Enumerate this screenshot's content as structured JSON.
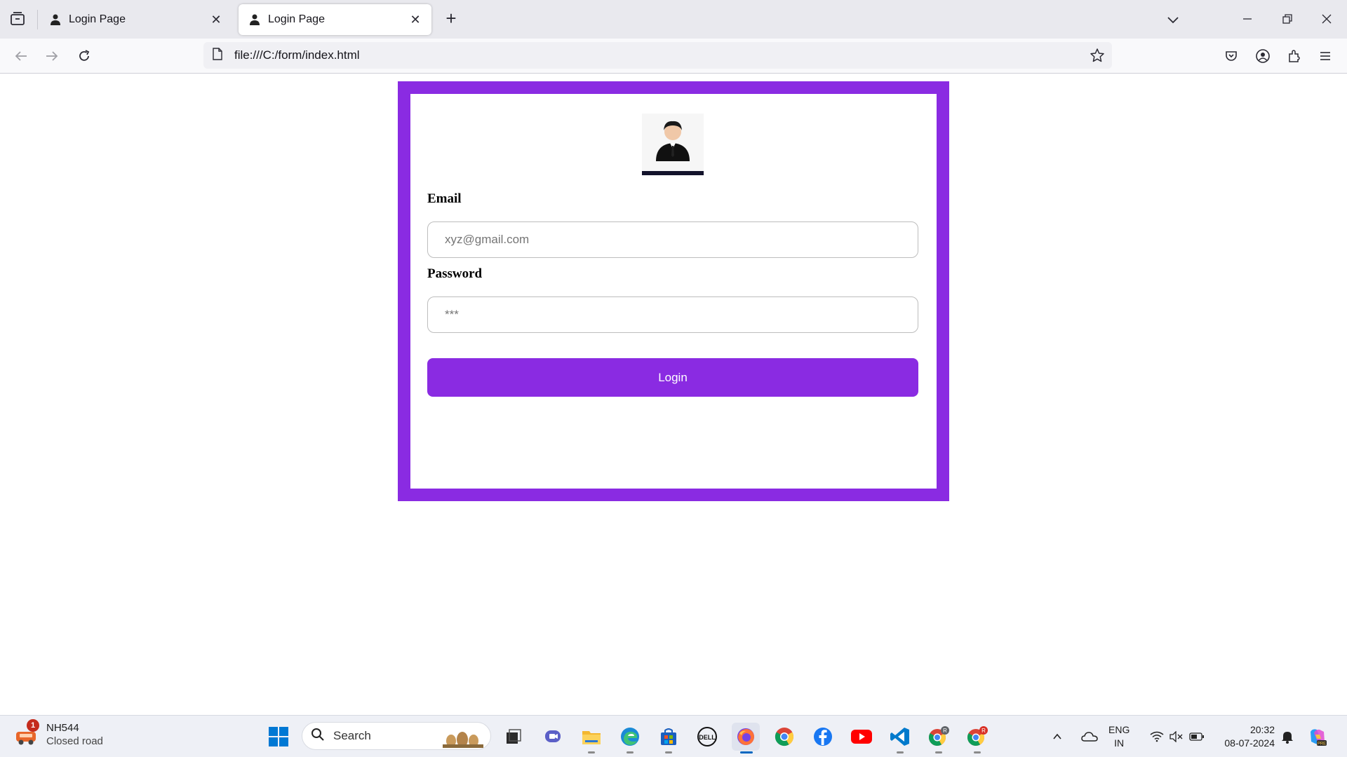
{
  "browser": {
    "tabs": [
      {
        "title": "Login Page",
        "active": false
      },
      {
        "title": "Login Page",
        "active": true
      }
    ],
    "url": "file:///C:/form/index.html"
  },
  "form": {
    "email_label": "Email",
    "email_placeholder": "xyz@gmail.com",
    "password_label": "Password",
    "password_placeholder": "***",
    "login_label": "Login",
    "accent_color": "#8a2be2"
  },
  "taskbar": {
    "weather_title": "NH544",
    "weather_subtitle": "Closed road",
    "weather_badge": "1",
    "search_label": "Search",
    "lang_line1": "ENG",
    "lang_line2": "IN",
    "time": "20:32",
    "date": "08-07-2024"
  }
}
